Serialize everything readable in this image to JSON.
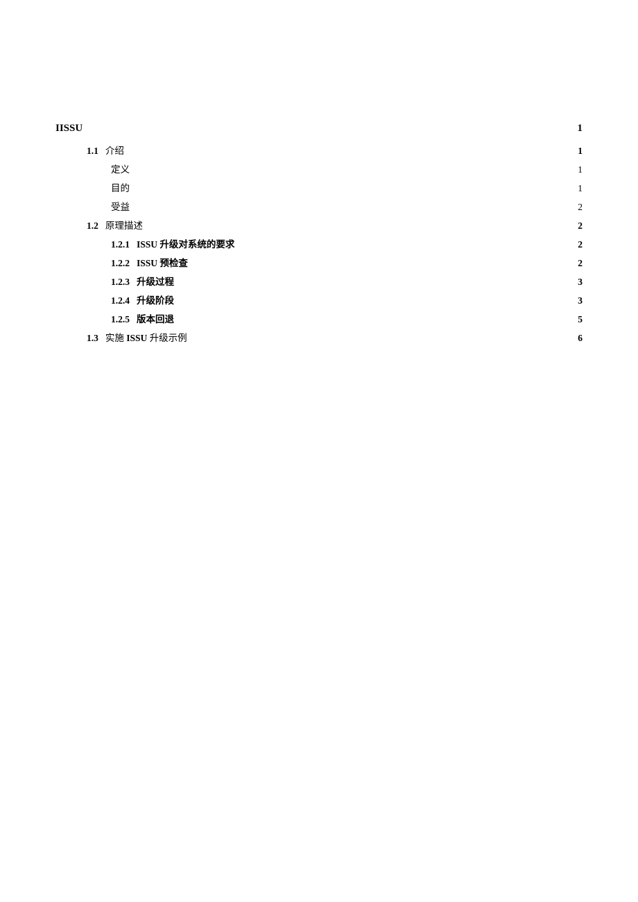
{
  "toc": {
    "title_row": {
      "title": "IISSU",
      "page": "1"
    },
    "entries": [
      {
        "indent": 1,
        "num": "1.1",
        "title": "介绍",
        "page": "1",
        "bold_num": true,
        "bold_row": false
      },
      {
        "indent": 2,
        "num": "",
        "title": "定义",
        "page": "1",
        "bold_num": false,
        "bold_row": false
      },
      {
        "indent": 2,
        "num": "",
        "title": "目的",
        "page": "1",
        "bold_num": false,
        "bold_row": false
      },
      {
        "indent": 2,
        "num": "",
        "title": "受益",
        "page": "2",
        "bold_num": false,
        "bold_row": false
      },
      {
        "indent": 1,
        "num": "1.2",
        "title": "原理描述",
        "page": "2",
        "bold_num": true,
        "bold_row": false
      },
      {
        "indent": 2,
        "num": "1.2.1",
        "title": "ISSU 升级对系统的要求",
        "page": "2",
        "bold_num": true,
        "bold_row": true
      },
      {
        "indent": 2,
        "num": "1.2.2",
        "title": "ISSU 预检查",
        "page": "2",
        "bold_num": true,
        "bold_row": true
      },
      {
        "indent": 2,
        "num": "1.2.3",
        "title": "升级过程",
        "page": "3",
        "bold_num": true,
        "bold_row": true
      },
      {
        "indent": 2,
        "num": "1.2.4",
        "title": "升级阶段",
        "page": "3",
        "bold_num": true,
        "bold_row": true
      },
      {
        "indent": 2,
        "num": "1.2.5",
        "title": "版本回退",
        "page": "5",
        "bold_num": true,
        "bold_row": true
      },
      {
        "indent": 1,
        "num": "1.3",
        "title_parts": [
          "实施 ",
          "ISSU",
          " 升级示例"
        ],
        "bold_title_part_index": 1,
        "page": "6",
        "bold_num": true,
        "bold_row": false
      }
    ]
  }
}
